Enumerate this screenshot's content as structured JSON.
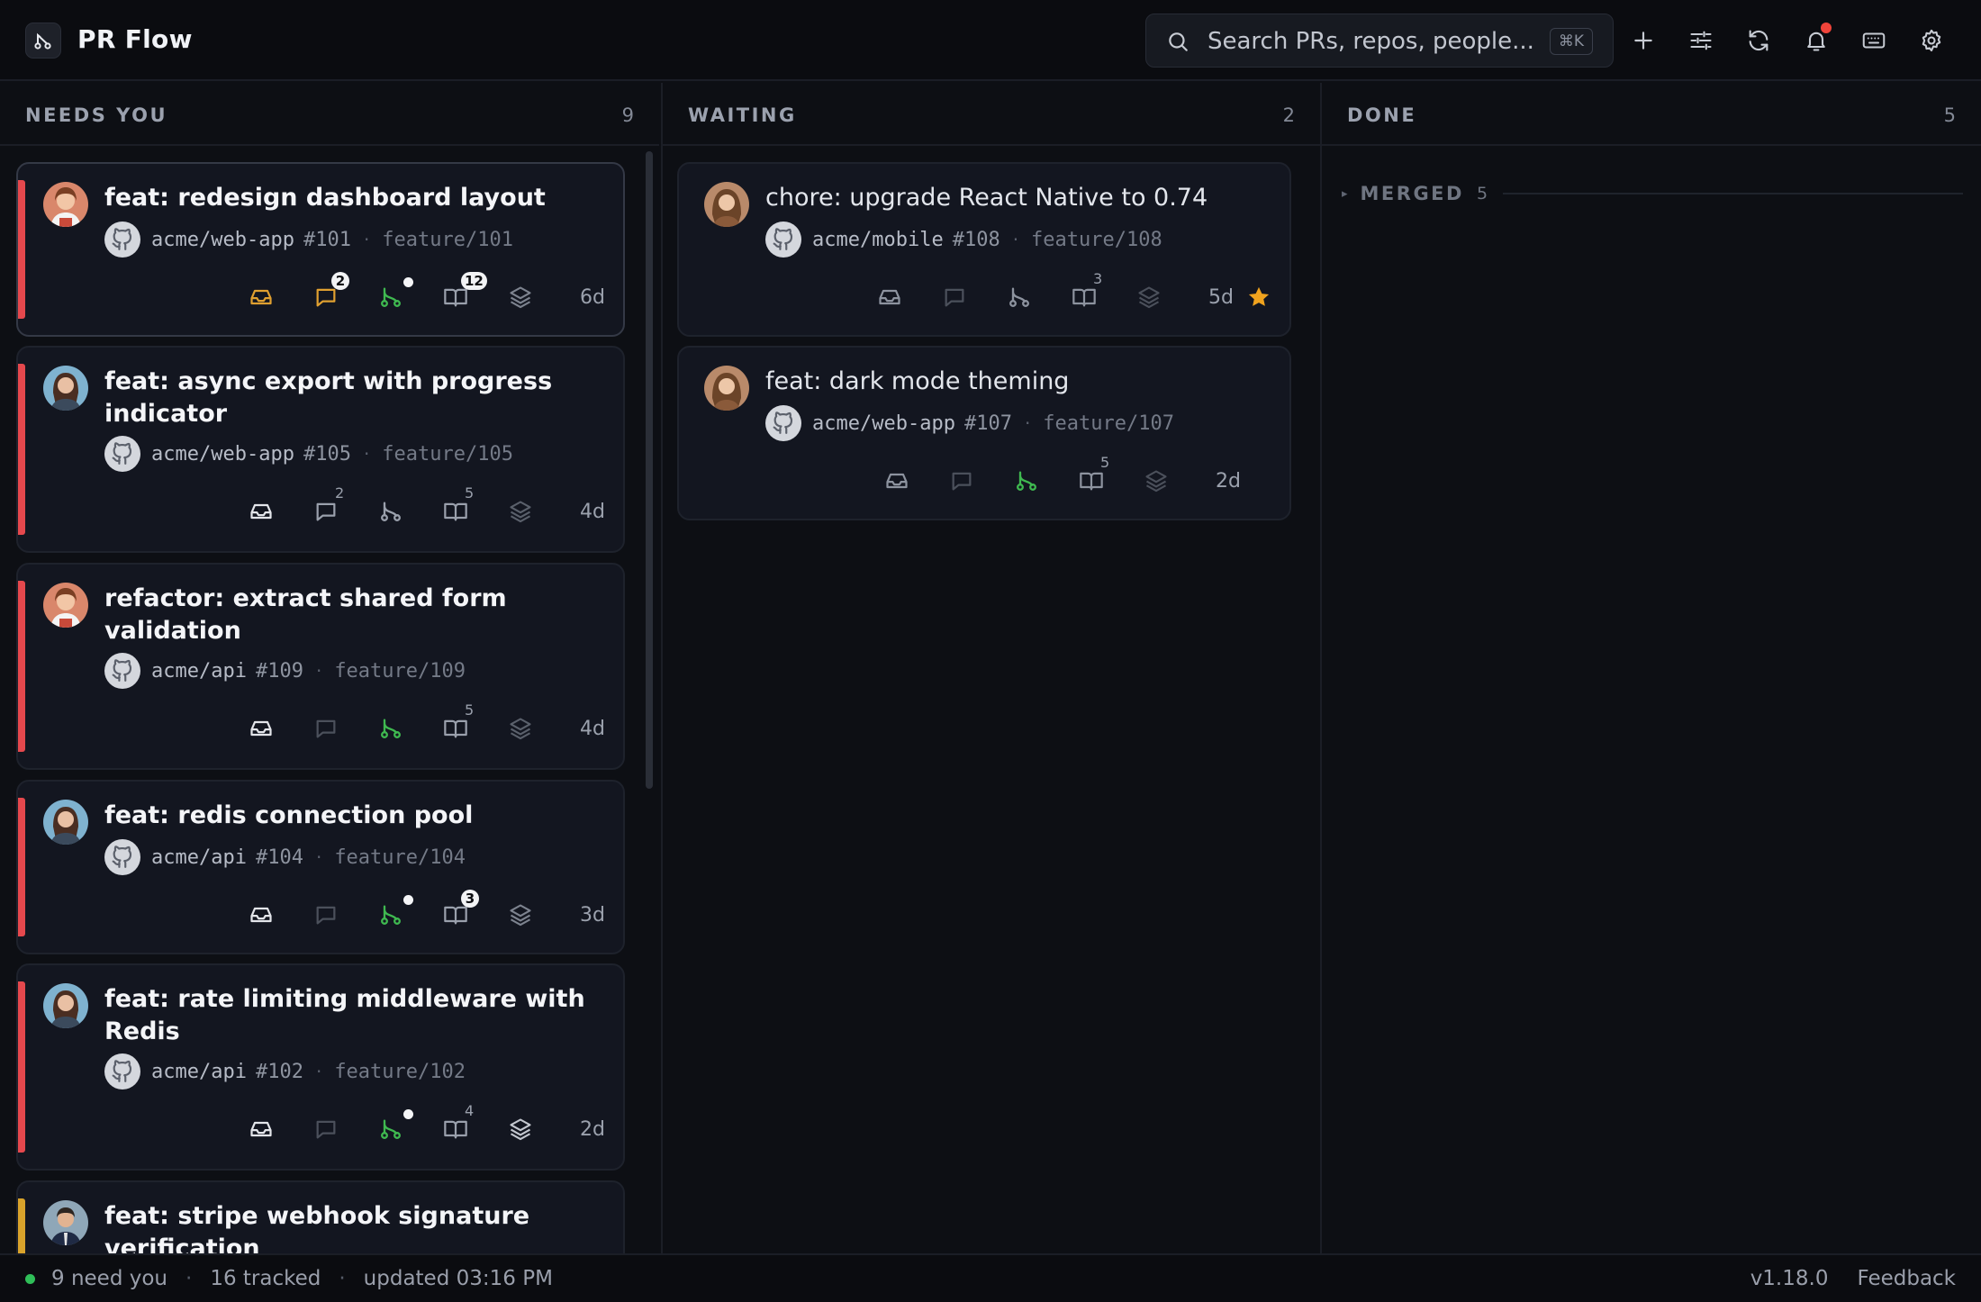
{
  "app": {
    "title": "PR Flow"
  },
  "search": {
    "placeholder": "Search PRs, repos, people...",
    "shortcut": "⌘K"
  },
  "toolbar": {
    "icons": [
      "plus-icon",
      "sliders-icon",
      "refresh-icon",
      "bell-icon",
      "keyboard-icon",
      "gear-icon"
    ],
    "notification_dot": true
  },
  "columns": {
    "needs_you": {
      "title": "NEEDS YOU",
      "count": "9",
      "cards": [
        {
          "title": "feat: redesign dashboard layout",
          "repo": "acme/web-app",
          "number": "#101",
          "branch": "feature/101",
          "age": "6d",
          "accent": "#e5484d",
          "comments": "2",
          "files": "12",
          "checks_dot": true
        },
        {
          "title": "feat: async export with progress indicator",
          "repo": "acme/web-app",
          "number": "#105",
          "branch": "feature/105",
          "age": "4d",
          "accent": "#e5484d",
          "comments": "2",
          "files": "5"
        },
        {
          "title": "refactor: extract shared form validation",
          "repo": "acme/api",
          "number": "#109",
          "branch": "feature/109",
          "age": "4d",
          "accent": "#e5484d",
          "files": "5"
        },
        {
          "title": "feat: redis connection pool",
          "repo": "acme/api",
          "number": "#104",
          "branch": "feature/104",
          "age": "3d",
          "accent": "#e5484d",
          "files": "3",
          "checks_dot": true
        },
        {
          "title": "feat: rate limiting middleware with Redis",
          "repo": "acme/api",
          "number": "#102",
          "branch": "feature/102",
          "age": "2d",
          "accent": "#e5484d",
          "files": "4",
          "checks_dot": true
        },
        {
          "title": "feat: stripe webhook signature verification",
          "accent": "#d9a32b"
        }
      ]
    },
    "waiting": {
      "title": "WAITING",
      "count": "2",
      "cards": [
        {
          "title": "chore: upgrade React Native to 0.74",
          "repo": "acme/mobile",
          "number": "#108",
          "branch": "feature/108",
          "age": "5d",
          "files": "3",
          "starred": true
        },
        {
          "title": "feat: dark mode theming",
          "repo": "acme/web-app",
          "number": "#107",
          "branch": "feature/107",
          "age": "2d",
          "files": "5"
        }
      ]
    },
    "done": {
      "title": "DONE",
      "count": "5",
      "group": {
        "label": "MERGED",
        "count": "5"
      }
    }
  },
  "statusbar": {
    "need_you": "9 need you",
    "tracked": "16 tracked",
    "updated": "updated 03:16 PM",
    "version": "v1.18.0",
    "feedback": "Feedback"
  },
  "colors": {
    "background": "#0d0f14",
    "card": "#131620",
    "accent_red": "#e5484d",
    "accent_yellow": "#d9a32b",
    "green": "#3fb950",
    "star": "#f0a31e"
  }
}
